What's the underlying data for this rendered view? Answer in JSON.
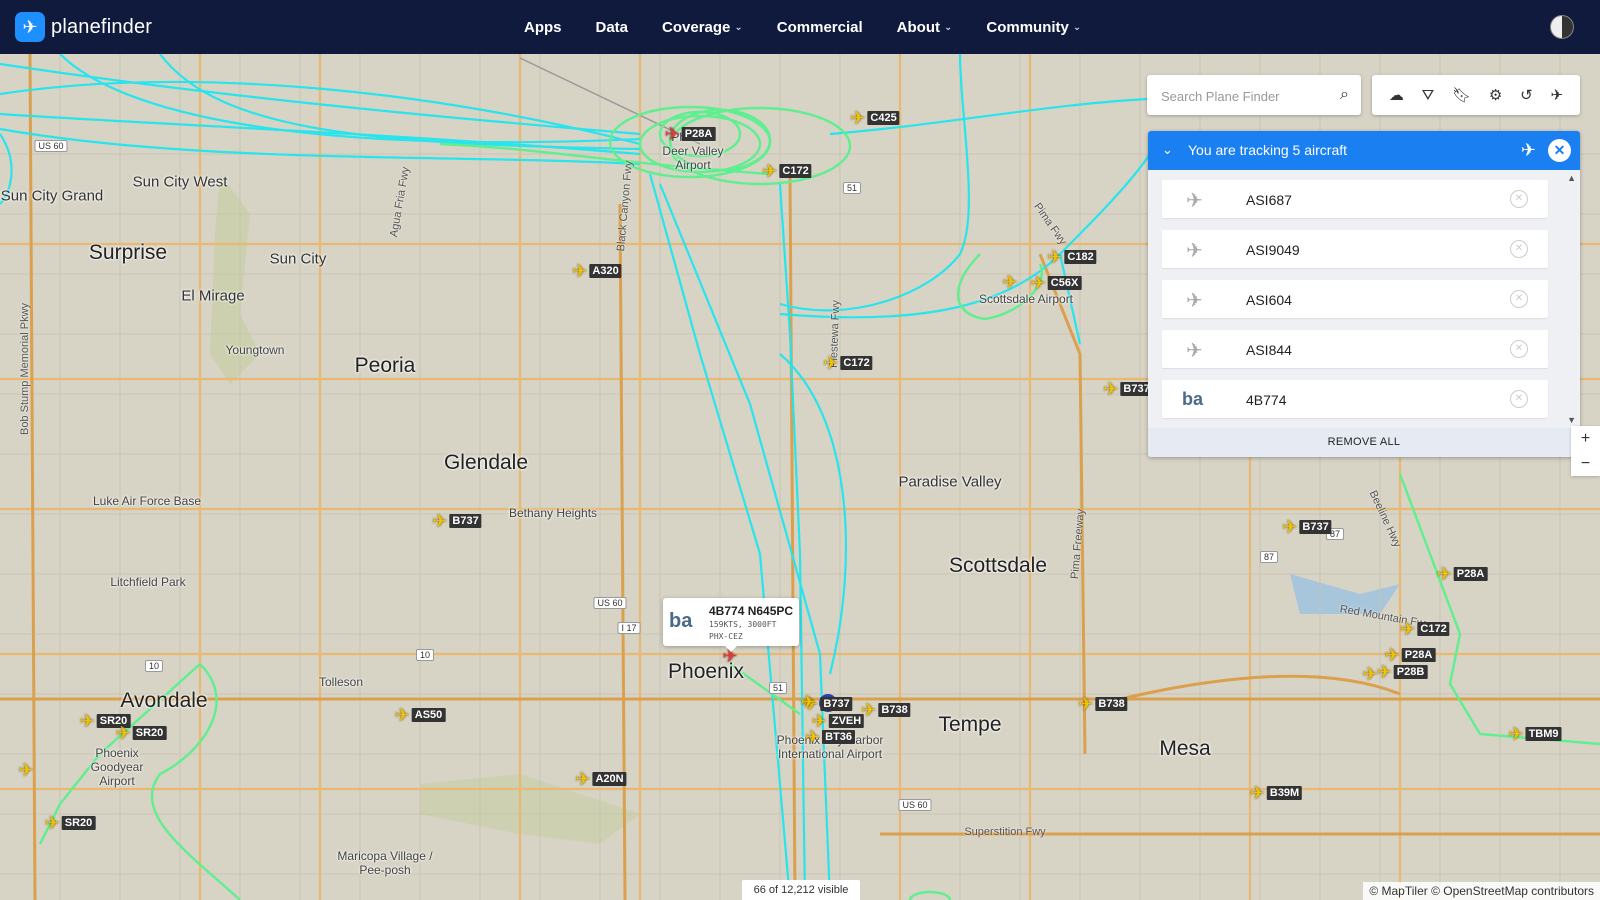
{
  "nav": {
    "brand": "planefinder",
    "links": [
      {
        "label": "Apps",
        "dropdown": false
      },
      {
        "label": "Data",
        "dropdown": false
      },
      {
        "label": "Coverage",
        "dropdown": true
      },
      {
        "label": "Commercial",
        "dropdown": false
      },
      {
        "label": "About",
        "dropdown": true
      },
      {
        "label": "Community",
        "dropdown": true
      }
    ]
  },
  "search": {
    "placeholder": "Search Plane Finder"
  },
  "toolbar": {
    "icons": [
      "cloud-icon",
      "filter-icon",
      "bookmark-icon",
      "settings-icon",
      "history-icon",
      "plane-settings-icon"
    ]
  },
  "tracking": {
    "title": "You are tracking 5 aircraft",
    "items": [
      {
        "label": "ASI687",
        "icon": "plane"
      },
      {
        "label": "ASI9049",
        "icon": "plane"
      },
      {
        "label": "ASI604",
        "icon": "plane"
      },
      {
        "label": "ASI844",
        "icon": "plane"
      },
      {
        "label": "4B774",
        "icon": "ba"
      }
    ],
    "remove_all": "REMOVE ALL"
  },
  "popup": {
    "title": "4B774 N645PC",
    "logo": "ba",
    "speed": "159KTS, 3000FT",
    "route": "PHX-CEZ"
  },
  "zoom": {
    "in": "+",
    "out": "−"
  },
  "visible_count": "66 of 12,212 visible",
  "attribution": "© MapTiler © OpenStreetMap contributors",
  "places": [
    {
      "name": "Sun City West",
      "size": "med"
    },
    {
      "name": "Sun City Grand",
      "size": "med"
    },
    {
      "name": "Surprise",
      "size": "big"
    },
    {
      "name": "Sun City",
      "size": "med"
    },
    {
      "name": "El Mirage",
      "size": "med"
    },
    {
      "name": "Youngtown",
      "size": "sm"
    },
    {
      "name": "Peoria",
      "size": "big"
    },
    {
      "name": "Glendale",
      "size": "big"
    },
    {
      "name": "Bethany Heights",
      "size": "sm"
    },
    {
      "name": "Luke Air Force Base",
      "size": "sm"
    },
    {
      "name": "Litchfield Park",
      "size": "sm"
    },
    {
      "name": "Paradise Valley",
      "size": "med"
    },
    {
      "name": "Scottsdale",
      "size": "big"
    },
    {
      "name": "Scottsdale Airport",
      "size": "sm"
    },
    {
      "name": "Phoenix",
      "size": "big"
    },
    {
      "name": "Tolleson",
      "size": "sm"
    },
    {
      "name": "Avondale",
      "size": "big"
    },
    {
      "name": "Phoenix Goodyear Airport",
      "size": "sm"
    },
    {
      "name": "Tempe",
      "size": "big"
    },
    {
      "name": "Mesa",
      "size": "big"
    },
    {
      "name": "Maricopa Village / Pee-posh",
      "size": "sm"
    },
    {
      "name": "Phoenix Deer Valley Airport",
      "size": "sm"
    },
    {
      "name": "Phoenix Sky Harbor International Airport",
      "size": "sm"
    }
  ],
  "road_labels": [
    "Bob Stump Memorial Pkwy",
    "Agua Fria Fwy",
    "Black Canyon Fwy",
    "Piestewa Fwy",
    "Pima Fwy",
    "Beeline Hwy",
    "Superstition Fwy",
    "Red Mountain Fwy",
    "Pima Freeway"
  ],
  "shields": [
    "US 60",
    "51",
    "US 60",
    "I 17",
    "10",
    "10",
    "51",
    "87",
    "87",
    "US 60"
  ],
  "aircraft": [
    {
      "label": "P28A",
      "color": "red"
    },
    {
      "label": "C425"
    },
    {
      "label": "C172"
    },
    {
      "label": "C182"
    },
    {
      "label": "C56X"
    },
    {
      "label": "A320"
    },
    {
      "label": "C172"
    },
    {
      "label": "B737"
    },
    {
      "label": "B737"
    },
    {
      "label": "B737"
    },
    {
      "label": "B738"
    },
    {
      "label": "ZVEH"
    },
    {
      "label": "BT36"
    },
    {
      "label": "B738"
    },
    {
      "label": "B737"
    },
    {
      "label": "P28A"
    },
    {
      "label": "C172"
    },
    {
      "label": "P28A"
    },
    {
      "label": "P28B"
    },
    {
      "label": "TBM9"
    },
    {
      "label": "B39M"
    },
    {
      "label": "AS50"
    },
    {
      "label": "A20N"
    },
    {
      "label": "SR20"
    },
    {
      "label": "SR20"
    },
    {
      "label": "SR20"
    }
  ],
  "colors": {
    "nav_bg": "#0f1a3c",
    "accent": "#1a7ff0",
    "track_cyan": "#1fe5f0",
    "track_green": "#5fef8f",
    "aircraft_yellow": "#f2c200"
  }
}
